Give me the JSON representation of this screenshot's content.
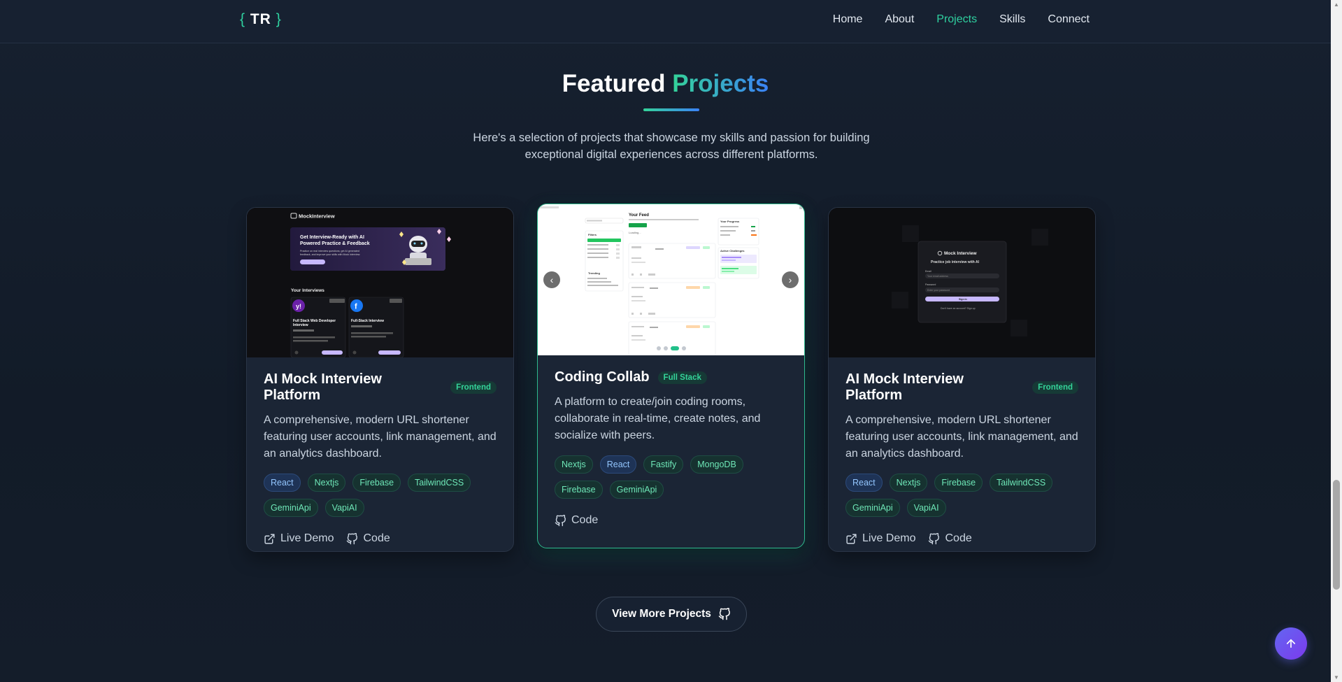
{
  "nav": {
    "logo_left": "{",
    "logo_text": "TR",
    "logo_right": "}",
    "links": [
      "Home",
      "About",
      "Projects",
      "Skills",
      "Connect"
    ],
    "active": "Projects"
  },
  "section": {
    "title_main": "Featured",
    "title_accent": "Projects",
    "subtitle": "Here's a selection of projects that showcase my skills and passion for building exceptional digital experiences across different platforms."
  },
  "cards": [
    {
      "title": "AI Mock Interview Platform",
      "badge": "Frontend",
      "description": "A comprehensive, modern URL shortener featuring user accounts, link management, and an analytics dashboard.",
      "tags": [
        "React",
        "Nextjs",
        "Firebase",
        "TailwindCSS",
        "GeminiApi",
        "VapiAI"
      ],
      "links": [
        "Live Demo",
        "Code"
      ],
      "screenshot": {
        "brand": "MockInterview",
        "hero_title": "Get Interview-Ready with AI Powered Practice & Feedback",
        "hero_text": "Practice on real interview questions, get AI generated feedback, and improve your skills with Mock interview.",
        "hero_button": "Start an Interview",
        "section": "Your Interviews",
        "items": [
          "Full Stack Web Developer Interview",
          "Full-Stack Interview"
        ],
        "item_badges": [
          "Technical",
          "Mixed"
        ],
        "item_buttons": [
          "Take Interview",
          "View Feedback"
        ]
      }
    },
    {
      "title": "Coding Collab",
      "badge": "Full Stack",
      "description": "A platform to create/join coding rooms, collaborate in real-time, create notes, and socialize with peers.",
      "tags": [
        "Nextjs",
        "React",
        "Fastify",
        "MongoDB",
        "Firebase",
        "GeminiApi"
      ],
      "links": [
        "Code"
      ],
      "screenshot": {
        "feed_title": "Your Feed",
        "feed_subtitle": "Discover, learn, and share Chess strategy with the community.",
        "filters": "Filters",
        "trending": "Trending",
        "progress": "Your Progress",
        "challenges": "Active Challenges",
        "post_button": "+ Create Post",
        "loading": "Loading..."
      }
    },
    {
      "title": "AI Mock Interview Platform",
      "badge": "Frontend",
      "description": "A comprehensive, modern URL shortener featuring user accounts, link management, and an analytics dashboard.",
      "tags": [
        "React",
        "Nextjs",
        "Firebase",
        "TailwindCSS",
        "GeminiApi",
        "VapiAI"
      ],
      "links": [
        "Live Demo",
        "Code"
      ],
      "screenshot": {
        "brand": "Mock Interview",
        "tagline": "Practice job interview with AI",
        "email_label": "Email",
        "email_placeholder": "Your email address",
        "password_label": "Password",
        "password_placeholder": "Enter your password",
        "button": "Sign in",
        "footer": "Don't have an account? Sign up"
      }
    }
  ],
  "view_more": "View More Projects",
  "colors": {
    "accent": "#2fd1a0",
    "blue_accent": "#3b82f6",
    "bg": "#141d2b",
    "card": "#1b2535"
  }
}
